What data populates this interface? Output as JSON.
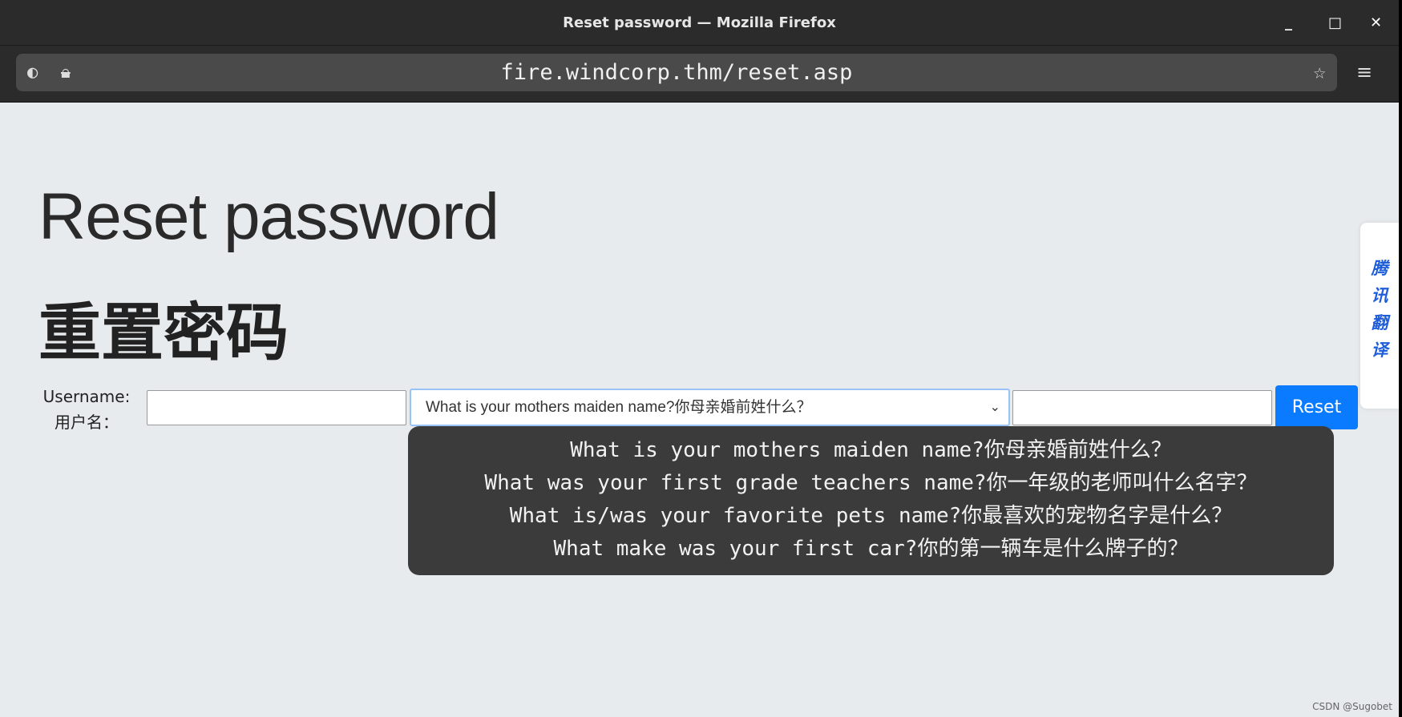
{
  "window": {
    "title": "Reset password — Mozilla Firefox",
    "controls": [
      "minimize",
      "maximize",
      "close"
    ]
  },
  "browser": {
    "url": "fire.windcorp.thm/reset.asp",
    "icons": [
      "shield-icon",
      "lock-slash-icon",
      "star-icon",
      "menu-icon"
    ]
  },
  "page": {
    "title": "Reset password",
    "title_cn": "重置密码",
    "username_label": "Username:",
    "username_label_cn": "用户名：",
    "username_value": "",
    "question_selected": "What is your mothers maiden name?你母亲婚前姓什么？",
    "answer_value": "",
    "reset_label": "Reset",
    "tooltip_lines": [
      "What is your mothers maiden name?你母亲婚前姓什么？",
      "What was your first grade teachers name?你一年级的老师叫什么名字？",
      "What is/was your favorite pets name?你最喜欢的宠物名字是什么？",
      "What make was your first car?你的第一辆车是什么牌子的？"
    ]
  },
  "translator": {
    "label": [
      "腾",
      "讯",
      "翻",
      "译"
    ],
    "color": "#1f5ed8"
  },
  "watermark": "CSDN @Sugobet",
  "colors": {
    "accent": "#0a7bff",
    "titlebar": "#2b2b2b",
    "page_bg": "#e8ebee"
  }
}
